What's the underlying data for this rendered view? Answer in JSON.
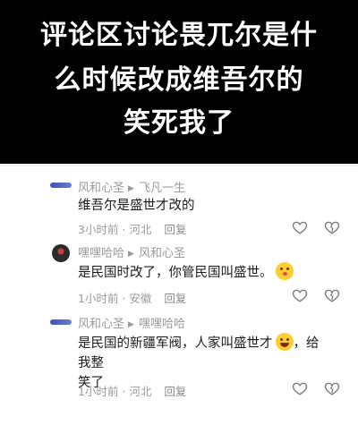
{
  "banner": {
    "line1": "评论区讨论畏兀尔是什",
    "line2": "么时候改成维吾尔的",
    "line3": "笑死我了"
  },
  "comments": [
    {
      "author": "风和心圣",
      "reply_to": "飞凡一生",
      "text": "维吾尔是盛世才改的",
      "time_location": "3小时前 · 河北",
      "reply_label": "回复",
      "avatar": "blue-pill-avatar"
    },
    {
      "author": "嘿嘿哈哈",
      "reply_to": "风和心圣",
      "text": "是民国时改了，你管民国叫盛世。",
      "time_location": "1小时前 · 安徽",
      "reply_label": "回复",
      "avatar": "dark-round-avatar",
      "emoji": "kissing-face-icon"
    },
    {
      "author": "风和心圣",
      "reply_to": "嘿嘿哈哈",
      "text_part1": "是民国的新疆军阀，人家叫盛世才",
      "text_part2": "，给我整",
      "text_part3": "笑了",
      "time_location": "1小时前 · 河北",
      "reply_label": "回复",
      "avatar": "blue-pill-avatar",
      "emoji": "laughing-tears-icon"
    }
  ],
  "icons": {
    "like": "heart-outline-icon",
    "dislike": "broken-heart-icon"
  },
  "colors": {
    "banner_bg": "#000000",
    "banner_text": "#ffffff",
    "meta_text": "#9a9a9a",
    "body_text": "#1a1a1a"
  }
}
